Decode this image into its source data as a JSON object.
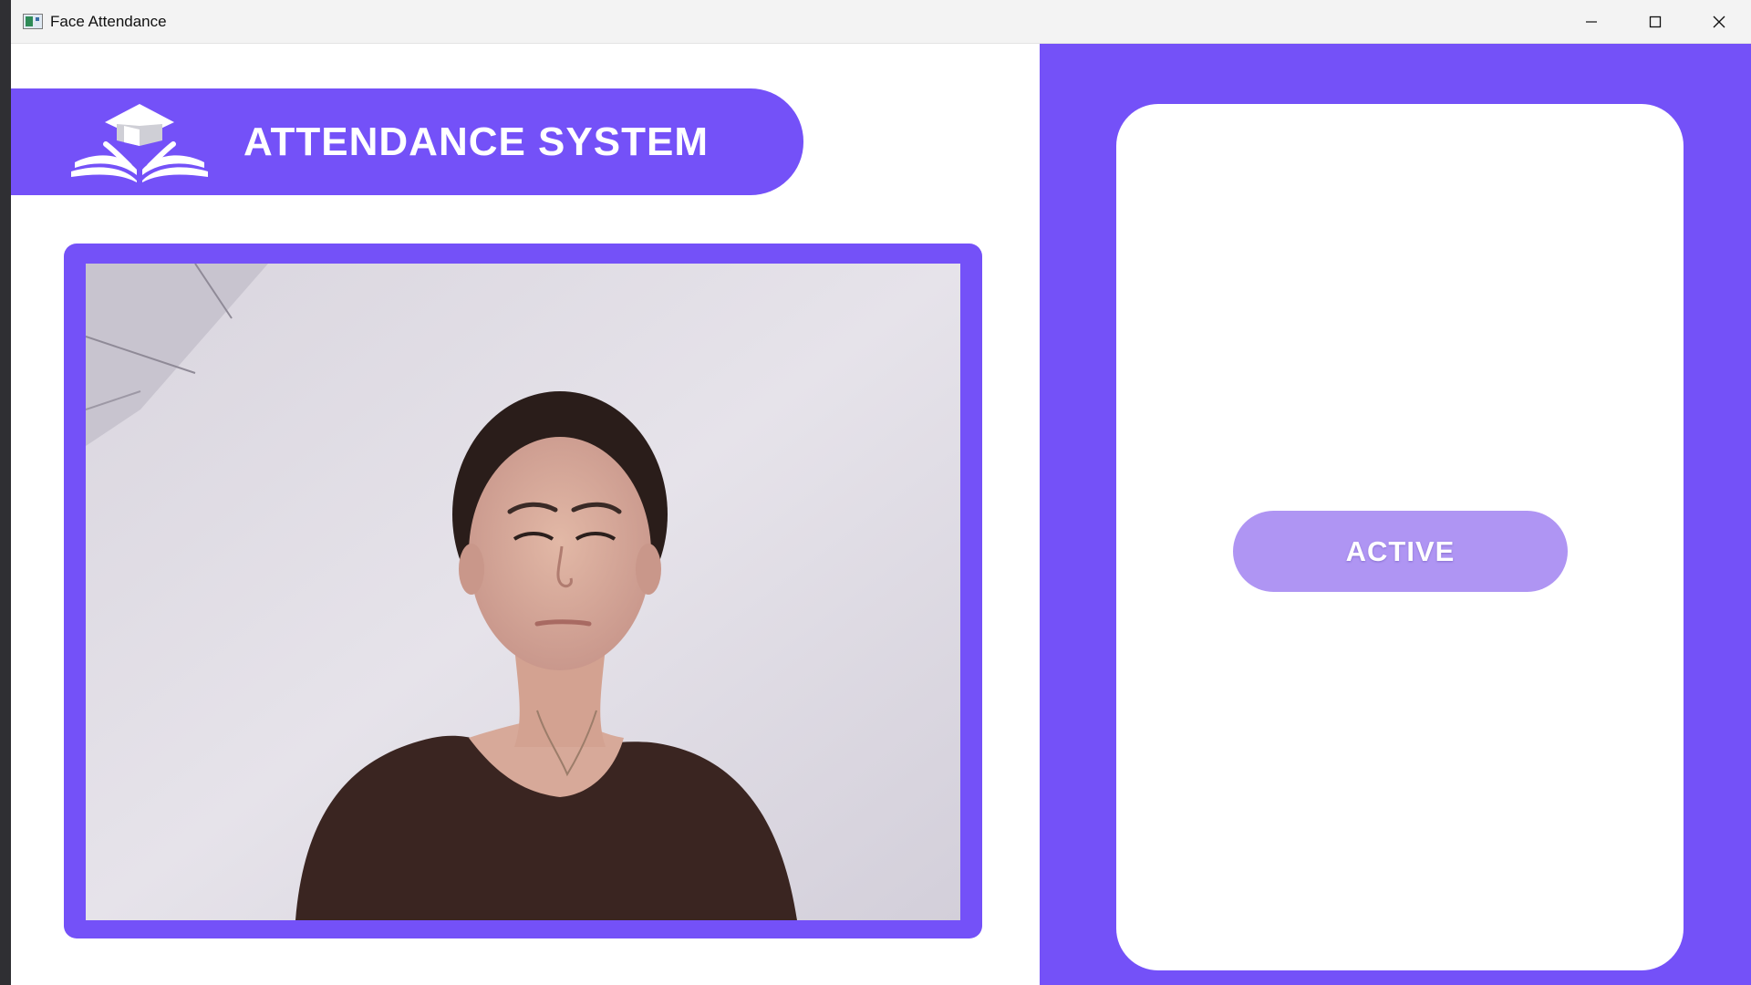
{
  "window": {
    "title": "Face Attendance",
    "icon": "app-icon"
  },
  "controls": {
    "minimize_icon": "minimize-icon",
    "maximize_icon": "maximize-icon",
    "close_icon": "close-icon"
  },
  "header": {
    "title": "ATTENDANCE SYSTEM",
    "logo_icon": "graduation-cap-book-icon"
  },
  "camera": {
    "feed_description_icon": "live-camera-feed"
  },
  "status": {
    "label": "ACTIVE"
  },
  "colors": {
    "accent": "#7451f8",
    "badge": "#af95f3",
    "background": "#ffffff"
  }
}
